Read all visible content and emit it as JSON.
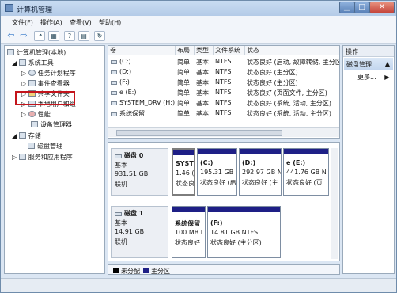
{
  "window": {
    "title": "计算机管理"
  },
  "menu": [
    {
      "label": "文件(F)"
    },
    {
      "label": "操作(A)"
    },
    {
      "label": "查看(V)"
    },
    {
      "label": "帮助(H)"
    }
  ],
  "tree": {
    "root": "计算机管理(本地)",
    "system_tools": "系统工具",
    "items": [
      "任务计划程序",
      "事件查看器",
      "共享文件夹",
      "本地用户和组",
      "性能",
      "设备管理器"
    ],
    "storage": "存储",
    "disk_management": "磁盘管理",
    "services": "服务和应用程序"
  },
  "volumes": {
    "columns": [
      "卷",
      "布局",
      "类型",
      "文件系统",
      "状态"
    ],
    "rows": [
      [
        "(C:)",
        "简单",
        "基本",
        "NTFS",
        "状态良好 (启动, 故障转储, 主分区"
      ],
      [
        "(D:)",
        "简单",
        "基本",
        "NTFS",
        "状态良好 (主分区)"
      ],
      [
        "(F:)",
        "简单",
        "基本",
        "NTFS",
        "状态良好 (主分区)"
      ],
      [
        "e (E:)",
        "简单",
        "基本",
        "NTFS",
        "状态良好 (页面文件, 主分区)"
      ],
      [
        "SYSTEM_DRV (H:)",
        "简单",
        "基本",
        "NTFS",
        "状态良好 (系统, 活动, 主分区)"
      ],
      [
        "系统保留",
        "简单",
        "基本",
        "NTFS",
        "状态良好 (系统, 活动, 主分区)"
      ]
    ]
  },
  "disks": [
    {
      "name": "磁盘 0",
      "type": "基本",
      "size": "931.51 GB",
      "state": "联机",
      "partitions": [
        {
          "title": "SYST",
          "line1": "1.46 (",
          "line2": "状态良"
        },
        {
          "title": "(C:)",
          "line1": "195.31 GB I",
          "line2": "状态良好 (启"
        },
        {
          "title": "(D:)",
          "line1": "292.97 GB N",
          "line2": "状态良好 (主"
        },
        {
          "title": "e  (E:)",
          "line1": "441.76 GB N",
          "line2": "状态良好 (页"
        }
      ]
    },
    {
      "name": "磁盘 1",
      "type": "基本",
      "size": "14.91 GB",
      "state": "联机",
      "partitions": [
        {
          "title": "系统保留",
          "line1": "100 MB I",
          "line2": "状态良好"
        },
        {
          "title": "(F:)",
          "line1": "14.81 GB NTFS",
          "line2": "状态良好 (主分区)"
        }
      ]
    }
  ],
  "legend": [
    {
      "label": "未分配",
      "color": "#000000"
    },
    {
      "label": "主分区",
      "color": "#1e1f86"
    }
  ],
  "actions": {
    "header": "操作",
    "section": "磁盘管理",
    "more": "更多..."
  }
}
